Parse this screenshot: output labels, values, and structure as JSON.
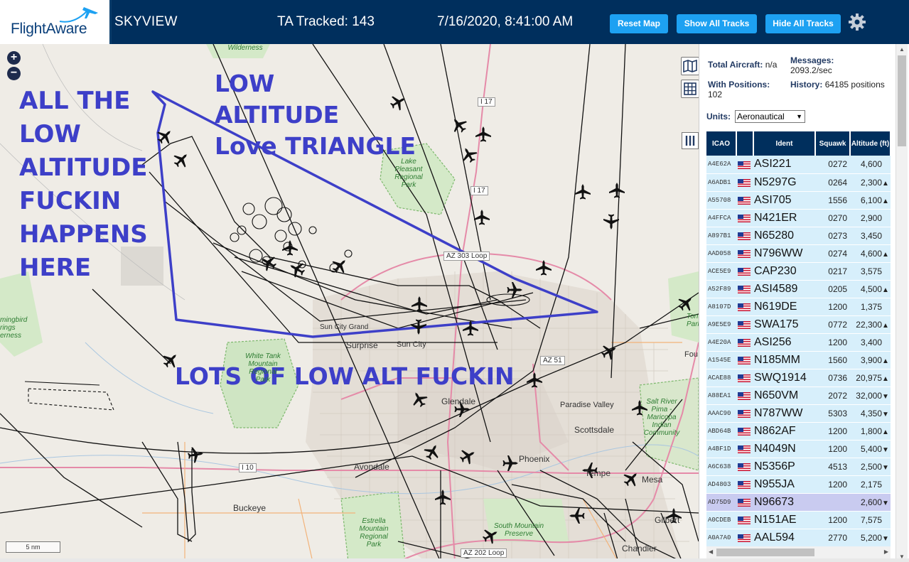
{
  "header": {
    "logo_text": "FlightAware",
    "app_title": "SKYVIEW",
    "tracked_label": "TA Tracked: 143",
    "datetime": "7/16/2020, 8:41:00 AM",
    "reset_label": "Reset Map",
    "show_label": "Show All Tracks",
    "hide_label": "Hide All Tracks",
    "settings_icon": "gear-icon",
    "brand_color": "#002f5d",
    "button_color": "#1da1f2"
  },
  "map": {
    "zoom_in": "+",
    "zoom_out": "−",
    "scale_label": "5 nm",
    "annotations": {
      "left": "ALL THE\nLOW\nALTITUDE\nFUCKIN\nHAPPENS\nHERE",
      "triangle": "LOW\nALTITUDE\nLove TRIANGLE",
      "bottom": "LOTS OF LOW ALT FUCKIN"
    },
    "annotation_color": "#3d3fc8",
    "cities": [
      "Surprise",
      "Sun City",
      "Sun City Grand",
      "Glendale",
      "Paradise Valley",
      "Scottsdale",
      "Phoenix",
      "Tempe",
      "Mesa",
      "Avondale",
      "Buckeye",
      "Chandler",
      "Gilbert",
      "Fou"
    ],
    "parks": [
      "Lake Pleasant Regional Park",
      "White Tank Mountain Regional Park",
      "Estrella Mountain Regional Park",
      "South Mountain Preserve",
      "Salt River Pima - Maricopa Indian Community",
      "mingbird rings erness",
      "Wilderness",
      "Tonto Park"
    ],
    "highways": [
      "I 17",
      "I 17",
      "AZ 303 Loop",
      "AZ 51",
      "I 10",
      "AZ 202 Loop"
    ]
  },
  "sidebar": {
    "total_aircraft_label": "Total Aircraft:",
    "total_aircraft_value": "n/a",
    "with_positions_label": "With Positions:",
    "with_positions_value": "102",
    "messages_label": "Messages:",
    "messages_value": "2093.2/sec",
    "history_label": "History:",
    "history_value": "64185 positions",
    "units_label": "Units:",
    "units_value": "Aeronautical",
    "columns": [
      "ICAO",
      "",
      "Ident",
      "Squawk",
      "Altitude (ft)"
    ],
    "rows": [
      {
        "icao": "A4E62A",
        "ident": "ASI221",
        "squawk": "0272",
        "alt": "4,600",
        "trend": ""
      },
      {
        "icao": "A6ADB1",
        "ident": "N5297G",
        "squawk": "0264",
        "alt": "2,300",
        "trend": "▲"
      },
      {
        "icao": "A55708",
        "ident": "ASI705",
        "squawk": "1556",
        "alt": "6,100",
        "trend": "▲"
      },
      {
        "icao": "A4FFCA",
        "ident": "N421ER",
        "squawk": "0270",
        "alt": "2,900",
        "trend": ""
      },
      {
        "icao": "A897B1",
        "ident": "N65280",
        "squawk": "0273",
        "alt": "3,450",
        "trend": ""
      },
      {
        "icao": "AAD058",
        "ident": "N796WW",
        "squawk": "0274",
        "alt": "4,600",
        "trend": "▲"
      },
      {
        "icao": "ACE5E9",
        "ident": "CAP230",
        "squawk": "0217",
        "alt": "3,575",
        "trend": ""
      },
      {
        "icao": "A52F89",
        "ident": "ASI4589",
        "squawk": "0205",
        "alt": "4,500",
        "trend": "▲"
      },
      {
        "icao": "A8107D",
        "ident": "N619DE",
        "squawk": "1200",
        "alt": "1,375",
        "trend": ""
      },
      {
        "icao": "A9E5E9",
        "ident": "SWA175",
        "squawk": "0772",
        "alt": "22,300",
        "trend": "▲"
      },
      {
        "icao": "A4E20A",
        "ident": "ASI256",
        "squawk": "1200",
        "alt": "3,400",
        "trend": ""
      },
      {
        "icao": "A1545E",
        "ident": "N185MM",
        "squawk": "1560",
        "alt": "3,900",
        "trend": "▲"
      },
      {
        "icao": "ACAE88",
        "ident": "SWQ1914",
        "squawk": "0736",
        "alt": "20,975",
        "trend": "▲"
      },
      {
        "icao": "A88EA1",
        "ident": "N650VM",
        "squawk": "2072",
        "alt": "32,000",
        "trend": "▼"
      },
      {
        "icao": "AAAC90",
        "ident": "N787WW",
        "squawk": "5303",
        "alt": "4,350",
        "trend": "▼"
      },
      {
        "icao": "ABD64B",
        "ident": "N862AF",
        "squawk": "1200",
        "alt": "1,800",
        "trend": "▲"
      },
      {
        "icao": "A4BF1D",
        "ident": "N4049N",
        "squawk": "1200",
        "alt": "5,400",
        "trend": "▼"
      },
      {
        "icao": "A6C638",
        "ident": "N5356P",
        "squawk": "4513",
        "alt": "2,500",
        "trend": "▼"
      },
      {
        "icao": "AD4803",
        "ident": "N955JA",
        "squawk": "1200",
        "alt": "2,175",
        "trend": ""
      },
      {
        "icao": "AD75D9",
        "ident": "N96673",
        "squawk": "",
        "alt": "2,600",
        "trend": "▼",
        "selected": true
      },
      {
        "icao": "A0CDEB",
        "ident": "N151AE",
        "squawk": "1200",
        "alt": "7,575",
        "trend": ""
      },
      {
        "icao": "A0A7A0",
        "ident": "AAL594",
        "squawk": "2770",
        "alt": "5,200",
        "trend": "▼"
      }
    ]
  }
}
